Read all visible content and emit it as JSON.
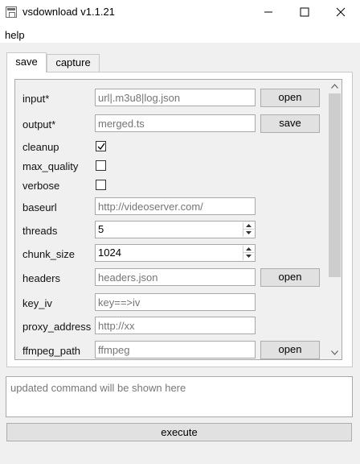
{
  "window": {
    "title": "vsdownload v1.1.21"
  },
  "menu": {
    "help": "help"
  },
  "tabs": [
    {
      "label": "save",
      "active": true
    },
    {
      "label": "capture",
      "active": false
    }
  ],
  "form": {
    "input": {
      "label": "input*",
      "placeholder": "url|.m3u8|log.json",
      "button": "open"
    },
    "output": {
      "label": "output*",
      "placeholder": "merged.ts",
      "button": "save"
    },
    "cleanup": {
      "label": "cleanup",
      "checked": true
    },
    "max_quality": {
      "label": "max_quality",
      "checked": false
    },
    "verbose": {
      "label": "verbose",
      "checked": false
    },
    "baseurl": {
      "label": "baseurl",
      "placeholder": "http://videoserver.com/"
    },
    "threads": {
      "label": "threads",
      "value": "5"
    },
    "chunk_size": {
      "label": "chunk_size",
      "value": "1024"
    },
    "headers": {
      "label": "headers",
      "placeholder": "headers.json",
      "button": "open"
    },
    "key_iv": {
      "label": "key_iv",
      "placeholder": "key==>iv"
    },
    "proxy_address": {
      "label": "proxy_address",
      "placeholder": "http://xx"
    },
    "ffmpeg_path": {
      "label": "ffmpeg_path",
      "placeholder": "ffmpeg",
      "button": "open"
    }
  },
  "command": {
    "placeholder": "updated command will be shown here"
  },
  "execute": {
    "label": "execute"
  },
  "icons": {
    "app": "window-app-icon",
    "minimize": "minimize-icon",
    "maximize": "maximize-icon",
    "close": "close-icon",
    "checkmark": "checkmark-icon"
  }
}
